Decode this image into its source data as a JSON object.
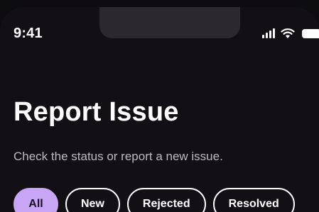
{
  "status_bar": {
    "time": "9:41",
    "icons": [
      "signal-icon",
      "wifi-icon",
      "battery-icon"
    ]
  },
  "header": {
    "title": "Report Issue",
    "subtitle": "Check the status or report a new issue."
  },
  "filters": {
    "active": "All",
    "items": [
      {
        "label": "All"
      },
      {
        "label": "New"
      },
      {
        "label": "Rejected"
      },
      {
        "label": "Resolved"
      }
    ]
  },
  "colors": {
    "background": "#121015",
    "accent": "#c9a6f5",
    "text": "#ffffff",
    "muted_text": "#bdbac0"
  }
}
